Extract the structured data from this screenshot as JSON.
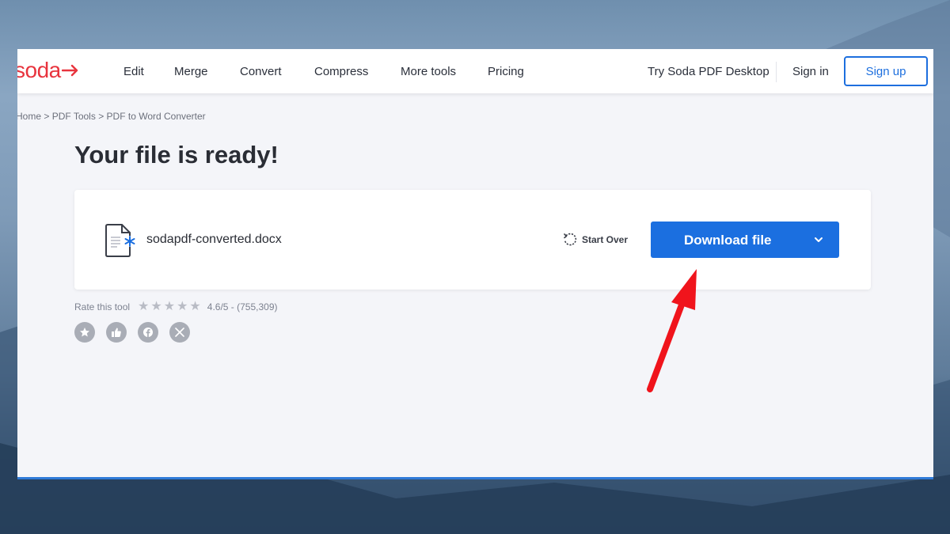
{
  "navbar": {
    "logo": "soda",
    "items": [
      "Edit",
      "Merge",
      "Convert",
      "Compress",
      "More tools",
      "Pricing"
    ],
    "desktop_link": "Try Soda PDF Desktop",
    "sign_in": "Sign in",
    "sign_up": "Sign up"
  },
  "breadcrumb": {
    "items": [
      "Home",
      "PDF Tools",
      "PDF to Word Converter"
    ],
    "separator": ">"
  },
  "main": {
    "title": "Your file is ready!",
    "file_name": "sodapdf-converted.docx",
    "start_over": "Start Over",
    "download": "Download file"
  },
  "rating": {
    "label": "Rate this tool",
    "stars_total": 5,
    "text": "4.6/5 - (755,309)"
  },
  "social": [
    "star-icon",
    "thumbs-up-icon",
    "facebook-icon",
    "x-icon"
  ],
  "colors": {
    "brand_red": "#e8343e",
    "accent_blue": "#1b6fe0",
    "arrow_red": "#f0141c"
  }
}
